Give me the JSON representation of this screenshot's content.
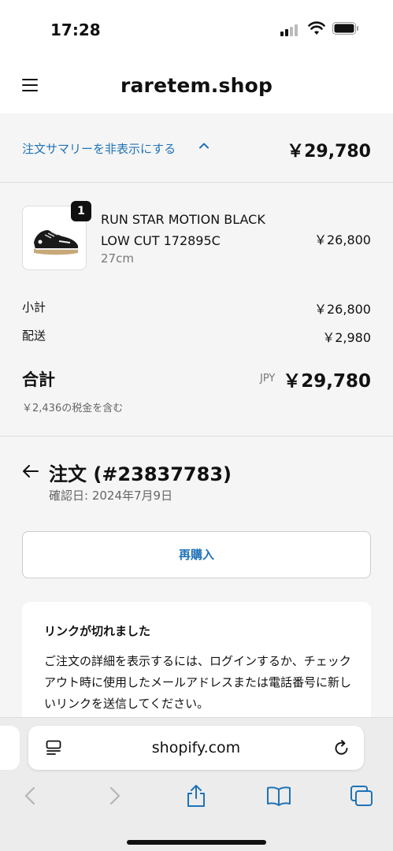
{
  "status_bar": {
    "time": "17:28"
  },
  "header": {
    "store_name": "raretem.shop"
  },
  "summary_toggle": {
    "label": "注文サマリーを非表示にする",
    "total": "￥29,780"
  },
  "line_item": {
    "quantity": "1",
    "name_line1": "RUN STAR MOTION BLACK",
    "name_line2": "LOW CUT 172895C",
    "variant": "27cm",
    "price": "￥26,800"
  },
  "totals": {
    "subtotal_label": "小計",
    "subtotal_value": "￥26,800",
    "shipping_label": "配送",
    "shipping_value": "￥2,980",
    "total_label": "合計",
    "currency": "JPY",
    "total_value": "￥29,780",
    "tax_note": "￥2,436の税金を含む"
  },
  "order": {
    "title": "注文 (#23837783)",
    "confirmed_date": "確認日: 2024年7月9日",
    "reorder_label": "再購入"
  },
  "link_card": {
    "title": "リンクが切れました",
    "body": "ご注文の詳細を表示するには、ログインするか、チェックアウト時に使用したメールアドレスまたは電話番号に新しいリンクを送信してください。"
  },
  "browser": {
    "domain": "shopify.com"
  },
  "colors": {
    "accent": "#1f73b7",
    "background": "#f5f5f5",
    "text": "#111111"
  }
}
